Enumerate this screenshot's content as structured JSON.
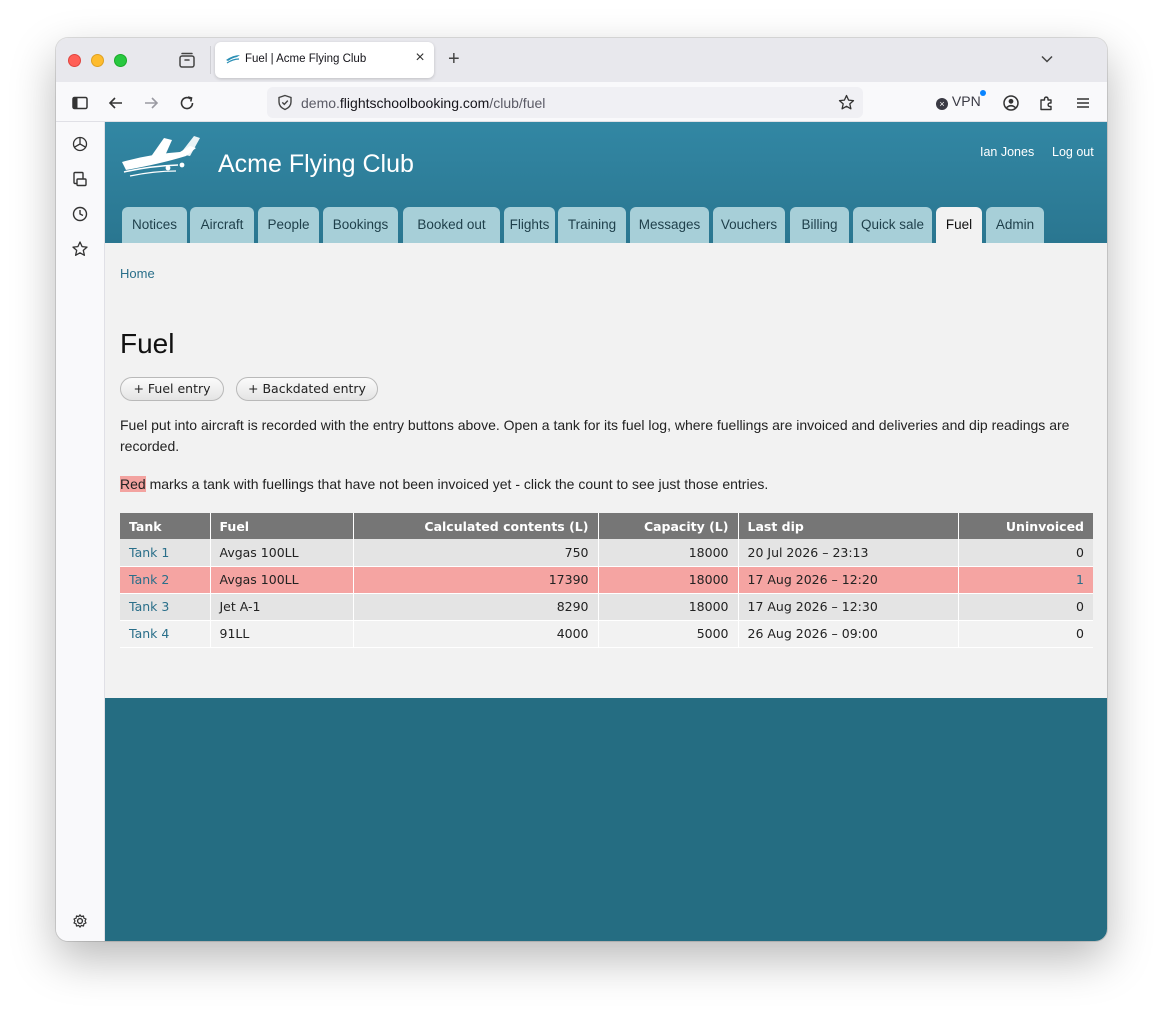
{
  "browser": {
    "tab_title": "Fuel | Acme Flying Club",
    "url_prefix": "demo.",
    "url_domain": "flightschoolbooking.com",
    "url_path": "/club/fuel",
    "vpn_label": "VPN"
  },
  "header": {
    "site_title": "Acme Flying Club",
    "user_name": "Ian Jones",
    "logout_label": "Log out"
  },
  "menu": [
    {
      "label": "Notices"
    },
    {
      "label": "Aircraft"
    },
    {
      "label": "People"
    },
    {
      "label": "Bookings"
    },
    {
      "label": "Booked out"
    },
    {
      "label": "Flights"
    },
    {
      "label": "Training"
    },
    {
      "label": "Messages"
    },
    {
      "label": "Vouchers"
    },
    {
      "label": "Billing"
    },
    {
      "label": "Quick sale"
    },
    {
      "label": "Fuel"
    },
    {
      "label": "Admin"
    }
  ],
  "page": {
    "breadcrumb": "Home",
    "title": "Fuel",
    "fuel_entry_label": "+ Fuel entry",
    "backdated_entry_label": "+ Backdated entry",
    "description": "Fuel put into aircraft is recorded with the entry buttons above. Open a tank for its fuel log, where fuellings are invoiced and deliveries and dip readings are recorded.",
    "red_word": "Red",
    "red_note": " marks a tank with fuellings that have not been invoiced yet - click the count to see just those entries."
  },
  "table": {
    "headers": {
      "tank": "Tank",
      "fuel": "Fuel",
      "contents": "Calculated contents (L)",
      "capacity": "Capacity (L)",
      "last_dip": "Last dip",
      "uninvoiced": "Uninvoiced"
    },
    "rows": [
      {
        "tank": "Tank 1",
        "fuel": "Avgas 100LL",
        "contents": "750",
        "capacity": "18000",
        "last_dip": "20 Jul 2026 – 23:13",
        "uninvoiced": "0"
      },
      {
        "tank": "Tank 2",
        "fuel": "Avgas 100LL",
        "contents": "17390",
        "capacity": "18000",
        "last_dip": "17 Aug 2026 – 12:20",
        "uninvoiced": "1"
      },
      {
        "tank": "Tank 3",
        "fuel": "Jet A-1",
        "contents": "8290",
        "capacity": "18000",
        "last_dip": "17 Aug 2026 – 12:30",
        "uninvoiced": "0"
      },
      {
        "tank": "Tank 4",
        "fuel": "91LL",
        "contents": "4000",
        "capacity": "5000",
        "last_dip": "26 Aug 2026 – 09:00",
        "uninvoiced": "0"
      }
    ]
  },
  "colors": {
    "brand_teal": "#2a7690",
    "flag_red": "#f5a4a2",
    "link": "#2a6f8a"
  }
}
